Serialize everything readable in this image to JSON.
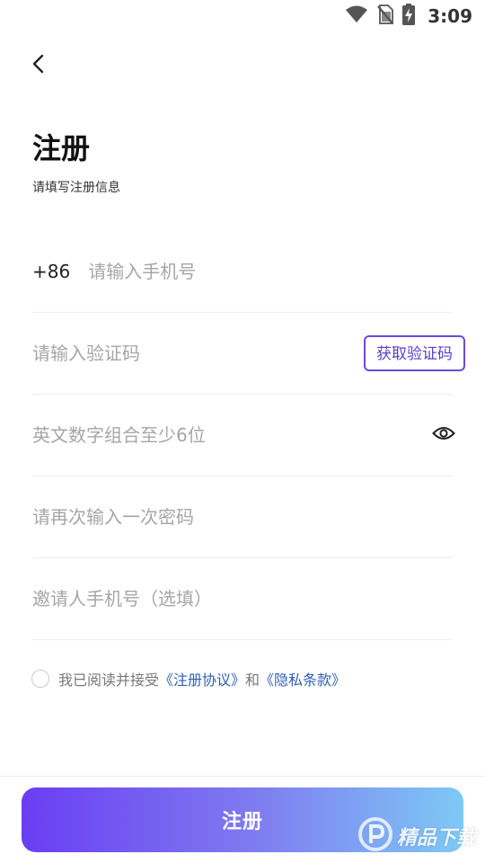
{
  "status_bar": {
    "time": "3:09",
    "icons": [
      "wifi-icon",
      "no-sim-icon",
      "battery-charging-icon"
    ]
  },
  "header": {
    "back_icon": "back-arrow-icon",
    "title": "注册",
    "subtitle": "请填写注册信息"
  },
  "form": {
    "phone": {
      "country_code": "+86",
      "placeholder": "请输入手机号",
      "value": ""
    },
    "verification": {
      "placeholder": "请输入验证码",
      "value": "",
      "button_label": "获取验证码"
    },
    "password": {
      "placeholder": "英文数字组合至少6位",
      "value": "",
      "toggle_icon": "eye-icon"
    },
    "confirm_password": {
      "placeholder": "请再次输入一次密码",
      "value": ""
    },
    "inviter": {
      "placeholder": "邀请人手机号（选填）",
      "value": ""
    }
  },
  "agreement": {
    "checked": false,
    "prefix": "我已阅读并接受",
    "link1": "《注册协议》",
    "connector": "和",
    "link2": "《隐私条款》"
  },
  "submit": {
    "label": "注册"
  },
  "watermark": {
    "text": "精品下载"
  },
  "colors": {
    "accent": "#6b4ad8",
    "link": "#2f5fb3",
    "gradient_start": "#6a3df2",
    "gradient_end": "#7ec9f5",
    "placeholder": "#a6a6a6"
  }
}
